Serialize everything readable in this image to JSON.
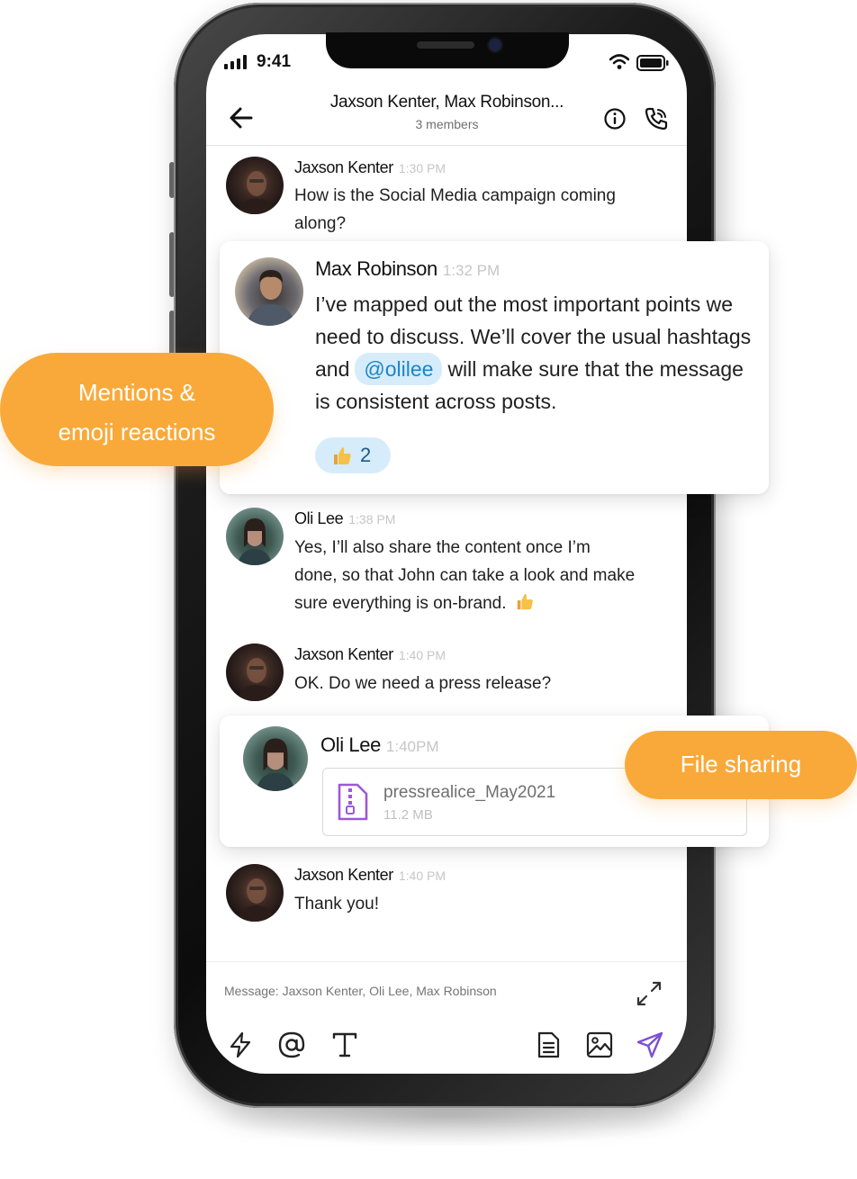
{
  "status_bar": {
    "time": "9:41"
  },
  "header": {
    "title": "Jaxson Kenter, Max Robinson...",
    "subtitle": "3 members"
  },
  "messages": [
    {
      "sender": "Jaxson Kenter",
      "time": "1:30 PM",
      "text": "How is the Social Media campaign coming along?"
    },
    {
      "sender": "Max Robinson",
      "time": "1:32 PM",
      "text_before": "I’ve mapped out the most important points we need to discuss. We’ll cover the usual hashtags and",
      "mention": "@olilee",
      "text_after": "will make sure that the message is consistent across posts.",
      "reaction": {
        "emoji": "thumbs-up",
        "count": "2"
      }
    },
    {
      "sender": "Oli Lee",
      "time": "1:38 PM",
      "text": "Yes, I’ll also share the content once I’m done, so that John can take a look and make sure everything is on-brand."
    },
    {
      "sender": "Jaxson Kenter",
      "time": "1:40 PM",
      "text": "OK. Do we need a press release?"
    },
    {
      "sender": "Oli Lee",
      "time": "1:40PM",
      "file": {
        "name": "pressrealice_May2021",
        "size": "11.2 MB"
      }
    },
    {
      "sender": "Jaxson Kenter",
      "time": "1:40 PM",
      "text": "Thank you!"
    }
  ],
  "composer": {
    "placeholder": "Message: Jaxson Kenter, Oli Lee, Max Robinson"
  },
  "callouts": {
    "mentions_line1": "Mentions &",
    "mentions_line2": "emoji reactions",
    "file_sharing": "File sharing"
  },
  "colors": {
    "accent_orange": "#f9a93a",
    "mention_bg": "#d6ecfb",
    "mention_text": "#1c85c7",
    "send_purple": "#7b4fd6",
    "file_icon_purple": "#9b59d6"
  }
}
